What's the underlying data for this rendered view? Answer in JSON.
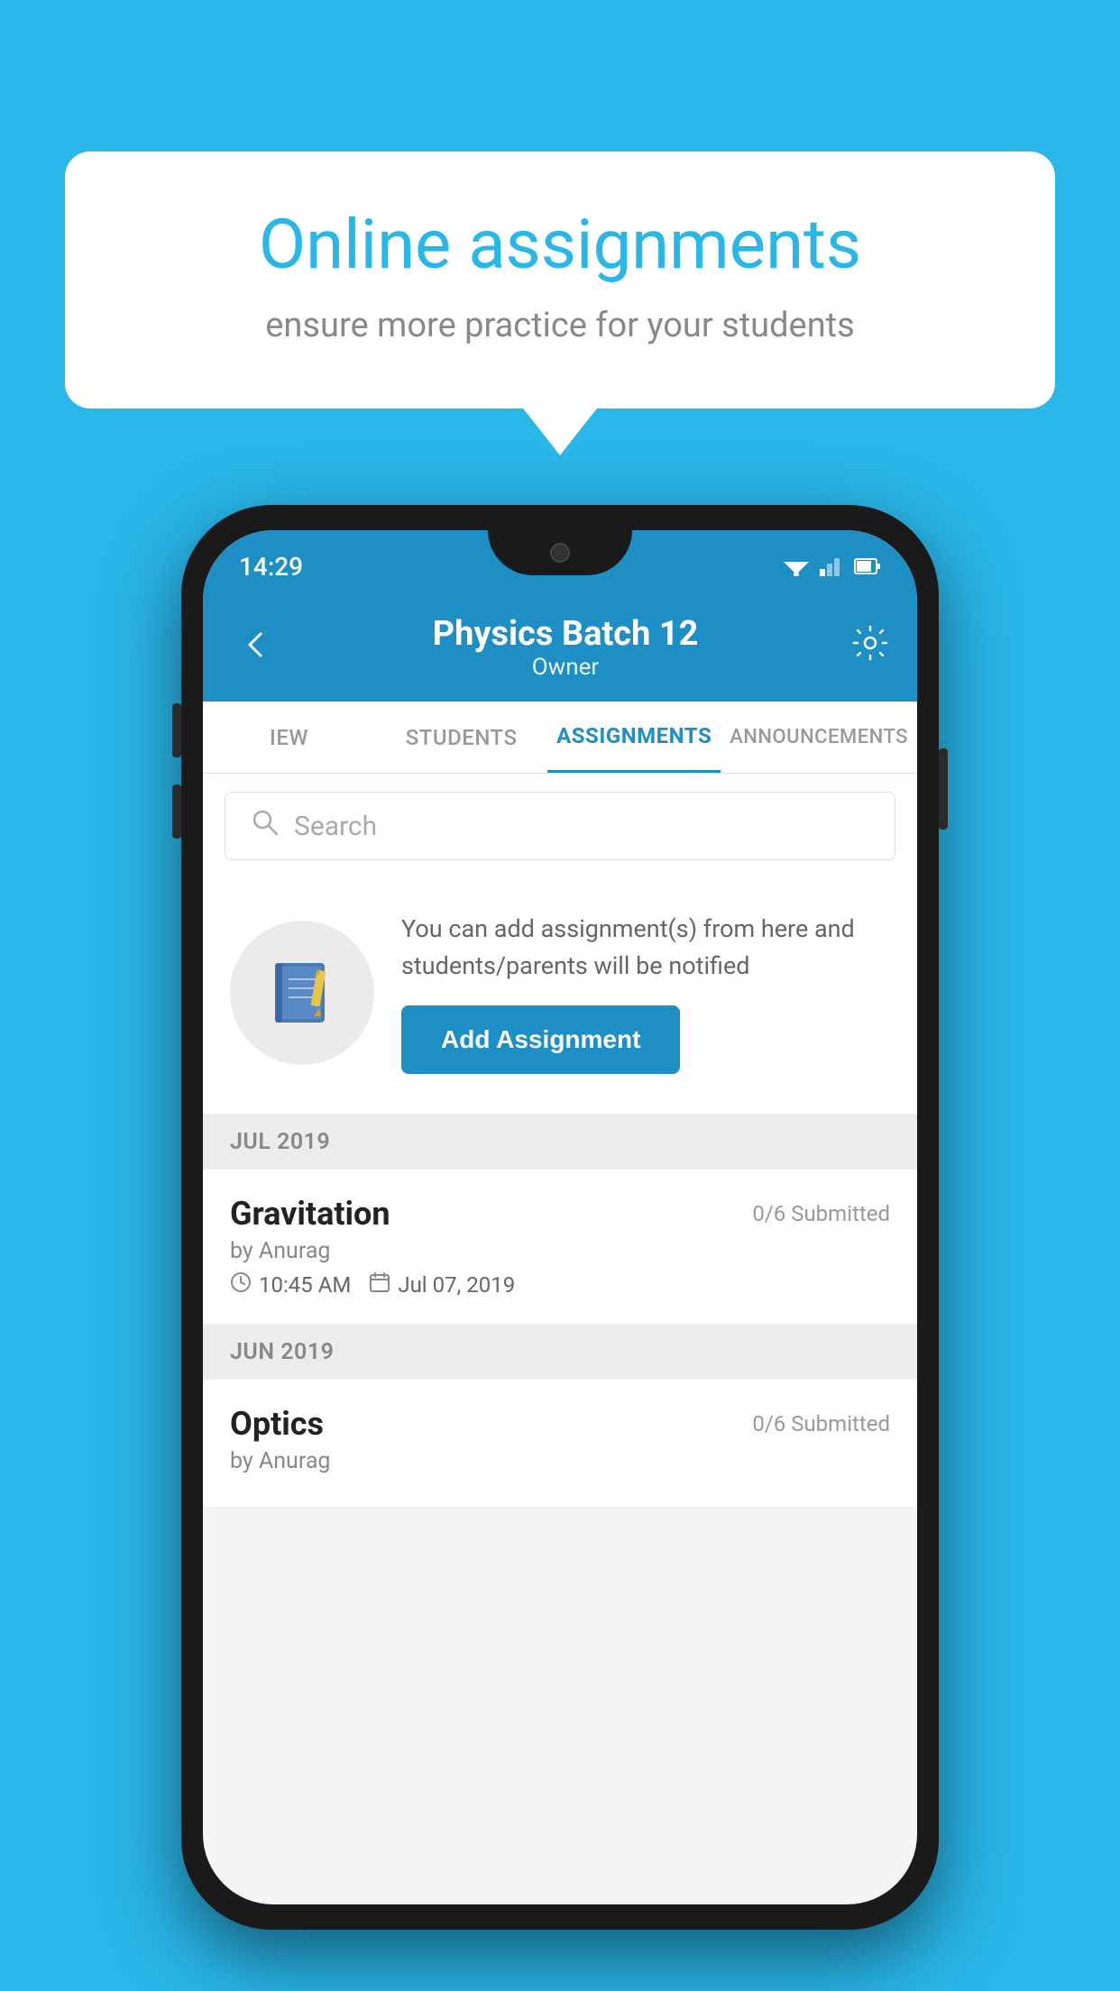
{
  "background_color": "#29b6e8",
  "speech_bubble": {
    "title": "Online assignments",
    "subtitle": "ensure more practice for your students"
  },
  "status_bar": {
    "time": "14:29"
  },
  "app_bar": {
    "title": "Physics Batch 12",
    "subtitle": "Owner"
  },
  "tabs": [
    {
      "label": "IEW",
      "active": false
    },
    {
      "label": "STUDENTS",
      "active": false
    },
    {
      "label": "ASSIGNMENTS",
      "active": true
    },
    {
      "label": "ANNOUNCEMENTS",
      "active": false
    }
  ],
  "search": {
    "placeholder": "Search"
  },
  "prompt": {
    "description": "You can add assignment(s) from here and students/parents will be notified",
    "button_label": "Add Assignment"
  },
  "sections": [
    {
      "month": "JUL 2019",
      "assignments": [
        {
          "title": "Gravitation",
          "submitted": "0/6 Submitted",
          "author": "by Anurag",
          "time": "10:45 AM",
          "date": "Jul 07, 2019"
        }
      ]
    },
    {
      "month": "JUN 2019",
      "assignments": [
        {
          "title": "Optics",
          "submitted": "0/6 Submitted",
          "author": "by Anurag",
          "time": "",
          "date": ""
        }
      ]
    }
  ]
}
